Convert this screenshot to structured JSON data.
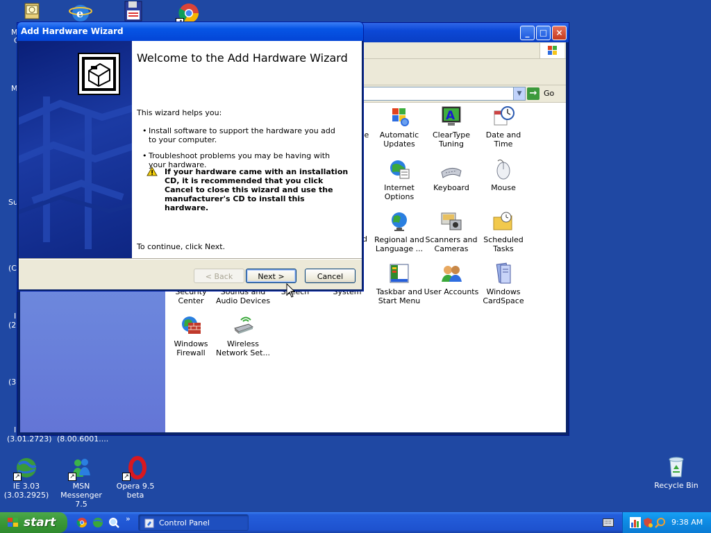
{
  "desktop": {
    "top_icons": [
      {
        "name": "network-icon"
      },
      {
        "name": "ie-icon"
      },
      {
        "name": "floppy-icon"
      },
      {
        "name": "chrome-icon"
      }
    ],
    "partial_labels": [
      "M",
      "C",
      "M",
      "Su",
      "(C",
      "I",
      "(2",
      "(3",
      "I"
    ],
    "row_labels": {
      "left": "(3.01.2723)",
      "right": "(8.00.6001...."
    },
    "bottom_icons": [
      {
        "line1": "IE 3.03",
        "line2": "(3.03.2925)"
      },
      {
        "line1": "MSN",
        "line2": "Messenger 7.5"
      },
      {
        "line1": "Opera 9.5 beta",
        "line2": ""
      }
    ],
    "recycle_bin": "Recycle Bin"
  },
  "control_panel": {
    "go_label": "Go",
    "items": [
      {
        "line1": "Automatic",
        "line2": "Updates",
        "icon": "windows-update-icon"
      },
      {
        "line1": "ClearType",
        "line2": "Tuning",
        "icon": "cleartype-icon"
      },
      {
        "line1": "Date and Time",
        "line2": "",
        "icon": "date-time-icon"
      },
      {
        "line1": "Internet",
        "line2": "Options",
        "icon": "internet-options-icon"
      },
      {
        "line1": "Keyboard",
        "line2": "",
        "icon": "keyboard-icon"
      },
      {
        "line1": "Mouse",
        "line2": "",
        "icon": "mouse-icon"
      },
      {
        "line1": "Regional and",
        "line2": "Language ...",
        "icon": "globe-icon"
      },
      {
        "line1": "Scanners and",
        "line2": "Cameras",
        "icon": "scanner-icon"
      },
      {
        "line1": "Scheduled",
        "line2": "Tasks",
        "icon": "scheduled-tasks-icon"
      },
      {
        "line1": "Security",
        "line2": "Center",
        "icon": "security-center-icon"
      },
      {
        "line1": "Sounds and",
        "line2": "Audio Devices",
        "icon": "sound-icon"
      },
      {
        "line1": "Speech",
        "line2": "",
        "icon": "speech-icon"
      },
      {
        "line1": "System",
        "line2": "",
        "icon": "system-icon"
      },
      {
        "line1": "Taskbar and",
        "line2": "Start Menu",
        "icon": "taskbar-icon"
      },
      {
        "line1": "User Accounts",
        "line2": "",
        "icon": "user-accounts-icon"
      },
      {
        "line1": "Windows",
        "line2": "CardSpace",
        "icon": "cardspace-icon"
      },
      {
        "line1": "Windows",
        "line2": "Firewall",
        "icon": "firewall-icon"
      },
      {
        "line1": "Wireless",
        "line2": "Network Set...",
        "icon": "wireless-icon"
      }
    ],
    "partial_labels": [
      "ve",
      "d"
    ]
  },
  "wizard": {
    "title": "Add Hardware Wizard",
    "heading": "Welcome to the Add Hardware Wizard",
    "intro": "This wizard helps you:",
    "bullets": [
      "Install software to support the hardware you add to your computer.",
      "Troubleshoot problems you may be having with your hardware."
    ],
    "warning": "If your hardware came with an installation CD, it is recommended that you click Cancel to close this wizard and use the manufacturer's CD to install this hardware.",
    "continue_text": "To continue, click Next.",
    "back_label": "< Back",
    "next_label": "Next >",
    "cancel_label": "Cancel"
  },
  "taskbar": {
    "start_label": "start",
    "quick_more": "»",
    "task_label": "Control Panel",
    "clock": "9:38 AM"
  },
  "colors": {
    "desktop": "#1f48a3",
    "titlebar": "#0655e5",
    "start_green": "#3c9a3a",
    "tray": "#0e8ee6"
  }
}
